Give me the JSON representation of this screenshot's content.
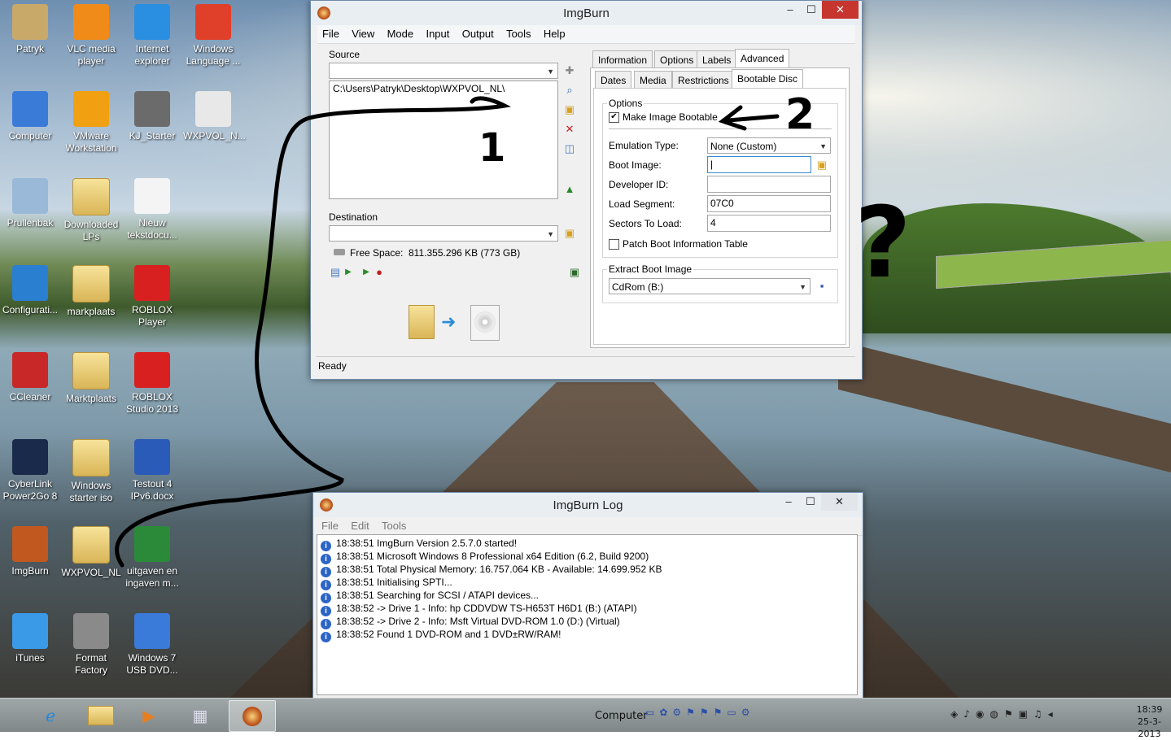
{
  "desktop_icons": [
    {
      "label": "Patryk",
      "icon": "user-folder-icon"
    },
    {
      "label": "VLC media player",
      "icon": "vlc-icon"
    },
    {
      "label": "Internet explorer",
      "icon": "internet-explorer-icon"
    },
    {
      "label": "Windows Language ...",
      "icon": "windows-language-icon"
    },
    {
      "label": "Computer",
      "icon": "computer-icon"
    },
    {
      "label": "VMware Workstation",
      "icon": "vmware-icon"
    },
    {
      "label": "KJ_Starter",
      "icon": "kj-starter-icon"
    },
    {
      "label": "WXPVOL_N...",
      "icon": "disc-image-icon"
    },
    {
      "label": "Prullenbak",
      "icon": "recycle-bin-icon"
    },
    {
      "label": "Downloaded LPs",
      "icon": "folder-icon"
    },
    {
      "label": "Nieuw tekstdocu...",
      "icon": "text-document-icon"
    },
    {
      "label": "Configurati...",
      "icon": "configuration-icon"
    },
    {
      "label": "markplaats",
      "icon": "folder-icon"
    },
    {
      "label": "ROBLOX Player",
      "icon": "roblox-icon"
    },
    {
      "label": "CCleaner",
      "icon": "ccleaner-icon"
    },
    {
      "label": "Marktplaats",
      "icon": "folder-icon"
    },
    {
      "label": "ROBLOX Studio 2013",
      "icon": "roblox-studio-icon"
    },
    {
      "label": "CyberLink Power2Go 8",
      "icon": "cyberlink-icon"
    },
    {
      "label": "Windows starter iso",
      "icon": "folder-icon"
    },
    {
      "label": "Testout 4 IPv6.docx",
      "icon": "word-document-icon"
    },
    {
      "label": "ImgBurn",
      "icon": "imgburn-icon"
    },
    {
      "label": "WXPVOL_NL",
      "icon": "folder-icon"
    },
    {
      "label": "uitgaven en ingaven m...",
      "icon": "excel-document-icon"
    },
    {
      "label": "iTunes",
      "icon": "itunes-icon"
    },
    {
      "label": "Format Factory",
      "icon": "format-factory-icon"
    },
    {
      "label": "Windows 7 USB DVD...",
      "icon": "windows7-usb-icon"
    }
  ],
  "imgburn": {
    "title": "ImgBurn",
    "menu": [
      "File",
      "View",
      "Mode",
      "Input",
      "Output",
      "Tools",
      "Help"
    ],
    "source_label": "Source",
    "source_path": "C:\\Users\\Patryk\\Desktop\\WXPVOL_NL\\",
    "destination_label": "Destination",
    "free_space_label": "Free Space:",
    "free_space_value": "811.355.296 KB  (773 GB)",
    "status": "Ready",
    "tabs_row1": [
      "Information",
      "Options",
      "Labels",
      "Advanced"
    ],
    "tabs_row2": [
      "Dates",
      "Media",
      "Restrictions",
      "Bootable Disc"
    ],
    "options_group": "Options",
    "make_bootable_label": "Make Image Bootable",
    "make_bootable_checked": true,
    "emulation_label": "Emulation Type:",
    "emulation_value": "None (Custom)",
    "boot_image_label": "Boot Image:",
    "boot_image_value": "",
    "developer_label": "Developer ID:",
    "developer_value": "",
    "load_segment_label": "Load Segment:",
    "load_segment_value": "07C0",
    "sectors_label": "Sectors To Load:",
    "sectors_value": "4",
    "patch_label": "Patch Boot Information Table",
    "extract_group": "Extract Boot Image",
    "extract_value": "CdRom (B:)"
  },
  "log": {
    "title": "ImgBurn Log",
    "menu": [
      "File",
      "Edit",
      "Tools"
    ],
    "lines": [
      "18:38:51 ImgBurn Version 2.5.7.0 started!",
      "18:38:51 Microsoft Windows 8 Professional x64 Edition (6.2, Build 9200)",
      "18:38:51 Total Physical Memory: 16.757.064 KB  -  Available: 14.699.952 KB",
      "18:38:51 Initialising SPTI...",
      "18:38:51 Searching for SCSI / ATAPI devices...",
      "18:38:52 -> Drive 1 - Info: hp CDDVDW TS-H653T H6D1 (B:) (ATAPI)",
      "18:38:52 -> Drive 2 - Info: Msft Virtual DVD-ROM 1.0 (D:) (Virtual)",
      "18:38:52 Found 1 DVD-ROM and 1 DVD±RW/RAM!"
    ]
  },
  "annotations": [
    "1",
    "2",
    "?"
  ],
  "taskbar": {
    "computer_label": "Computer",
    "time": "18:39",
    "date": "25-3-2013"
  }
}
